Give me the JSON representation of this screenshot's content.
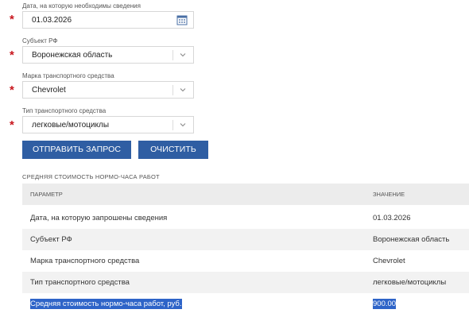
{
  "form": {
    "date": {
      "label": "Дата, на которую необходимы сведения",
      "value": "01.03.2026",
      "icon": "calendar-icon"
    },
    "region": {
      "label": "Субъект РФ",
      "value": "Воронежская область",
      "icon": "chevron-down-icon"
    },
    "brand": {
      "label": "Марка транспортного средства",
      "value": "Chevrolet",
      "icon": "chevron-down-icon"
    },
    "vehicle_type": {
      "label": "Тип транспортного средства",
      "value": "легковые/мотоциклы",
      "icon": "chevron-down-icon"
    },
    "required_marker": "*",
    "required_color": "#c8161d"
  },
  "buttons": {
    "submit_label": "ОТПРАВИТЬ ЗАПРОС",
    "clear_label": "ОЧИСТИТЬ",
    "color": "#2f5ea3"
  },
  "results": {
    "title": "СРЕДНЯЯ СТОИМОСТЬ НОРМО-ЧАСА РАБОТ",
    "headers": {
      "parameter": "ПАРАМЕТР",
      "value": "ЗНАЧЕНИЕ"
    },
    "rows": [
      {
        "parameter": "Дата, на которую запрошены сведения",
        "value": "01.03.2026"
      },
      {
        "parameter": "Субъект РФ",
        "value": "Воронежская область"
      },
      {
        "parameter": "Марка транспортного средства",
        "value": "Chevrolet"
      },
      {
        "parameter": "Тип транспортного средства",
        "value": "легковые/мотоциклы"
      },
      {
        "parameter": "Средняя стоимость нормо-часа работ, руб.",
        "value": "900.00",
        "selected": true
      }
    ],
    "selection_color": "#2e64c8"
  }
}
